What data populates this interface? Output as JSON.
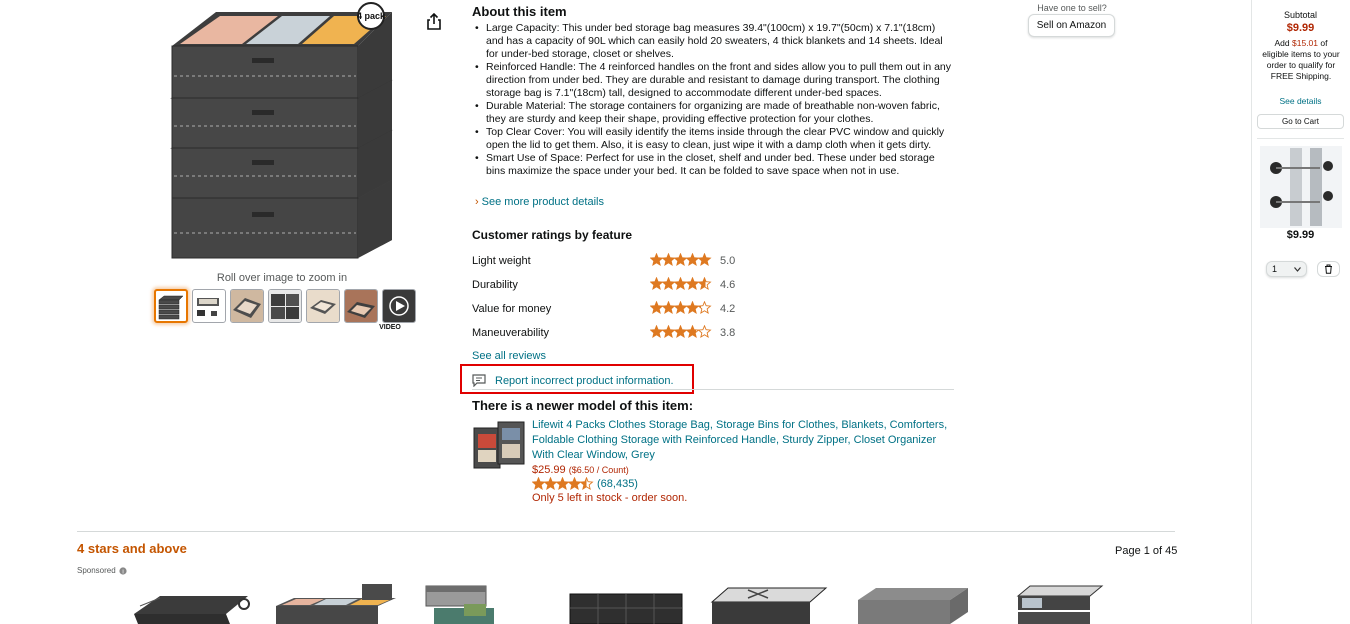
{
  "gallery": {
    "zoom_hint": "Roll over image to zoom in",
    "badge": "4 pack",
    "video_label": "VIDEO",
    "thumbnails": [
      "image-1",
      "image-2",
      "image-3",
      "image-4",
      "image-5",
      "image-6",
      "video"
    ]
  },
  "about": {
    "title": "About this item",
    "bullets": [
      "Large Capacity: This under bed storage bag measures 39.4\"(100cm) x 19.7\"(50cm) x 7.1\"(18cm) and has a capacity of 90L which can easily hold 20 sweaters, 4 thick blankets and 14 sheets. Ideal for under-bed storage, closet or shelves.",
      "Reinforced Handle: The 4 reinforced handles on the front and sides allow you to pull them out in any direction from under bed. They are durable and resistant to damage during transport. The clothing storage bag is 7.1\"(18cm) tall, designed to accommodate different under-bed spaces.",
      "Durable Material: The storage containers for organizing are made of breathable non-woven fabric, they are sturdy and keep their shape, providing effective protection for your clothes.",
      "Top Clear Cover: You will easily identify the items inside through the clear PVC window and quickly open the lid to get them. Also, it is easy to clean, just wipe it with a damp cloth when it gets dirty.",
      "Smart Use of Space: Perfect for use in the closet, shelf and under bed. These under bed storage bins maximize the space under your bed. It can be folded to save space when not in use."
    ],
    "see_more": "See more product details"
  },
  "ratings": {
    "title": "Customer ratings by feature",
    "features": [
      {
        "label": "Light weight",
        "value": "5.0",
        "score": 5.0
      },
      {
        "label": "Durability",
        "value": "4.6",
        "score": 4.6
      },
      {
        "label": "Value for money",
        "value": "4.2",
        "score": 4.2
      },
      {
        "label": "Maneuverability",
        "value": "3.8",
        "score": 3.8
      }
    ],
    "see_all": "See all reviews",
    "report": "Report incorrect product information."
  },
  "newer_model": {
    "title": "There is a newer model of this item:",
    "name": "Lifewit 4 Packs Clothes Storage Bag, Storage Bins for Clothes, Blankets, Comforters, Foldable Clothing Storage with Reinforced Handle, Sturdy Zipper, Closet Organizer With Clear Window, Grey",
    "price": "$25.99",
    "unit_price": "($6.50 / Count)",
    "rating_count": "(68,435)",
    "score": 4.5,
    "stock": "Only 5 left in stock - order soon."
  },
  "sell": {
    "have_one": "Have one to sell?",
    "button": "Sell on Amazon"
  },
  "bottom": {
    "heading": "4 stars and above",
    "page": "Page 1 of 45",
    "sponsored": "Sponsored"
  },
  "cart": {
    "subtotal_label": "Subtotal",
    "subtotal": "$9.99",
    "add_prefix": "Add ",
    "add_amount": "$15.01",
    "add_suffix": " of eligible items to your order to qualify for FREE Shipping.",
    "see_details": "See details",
    "go_to_cart": "Go to Cart",
    "item_price": "$9.99",
    "qty": "1"
  },
  "colors": {
    "link": "#007185",
    "price": "#b12704",
    "star": "#de7921",
    "heading_orange": "#c45500",
    "highlight": "#e00000"
  }
}
